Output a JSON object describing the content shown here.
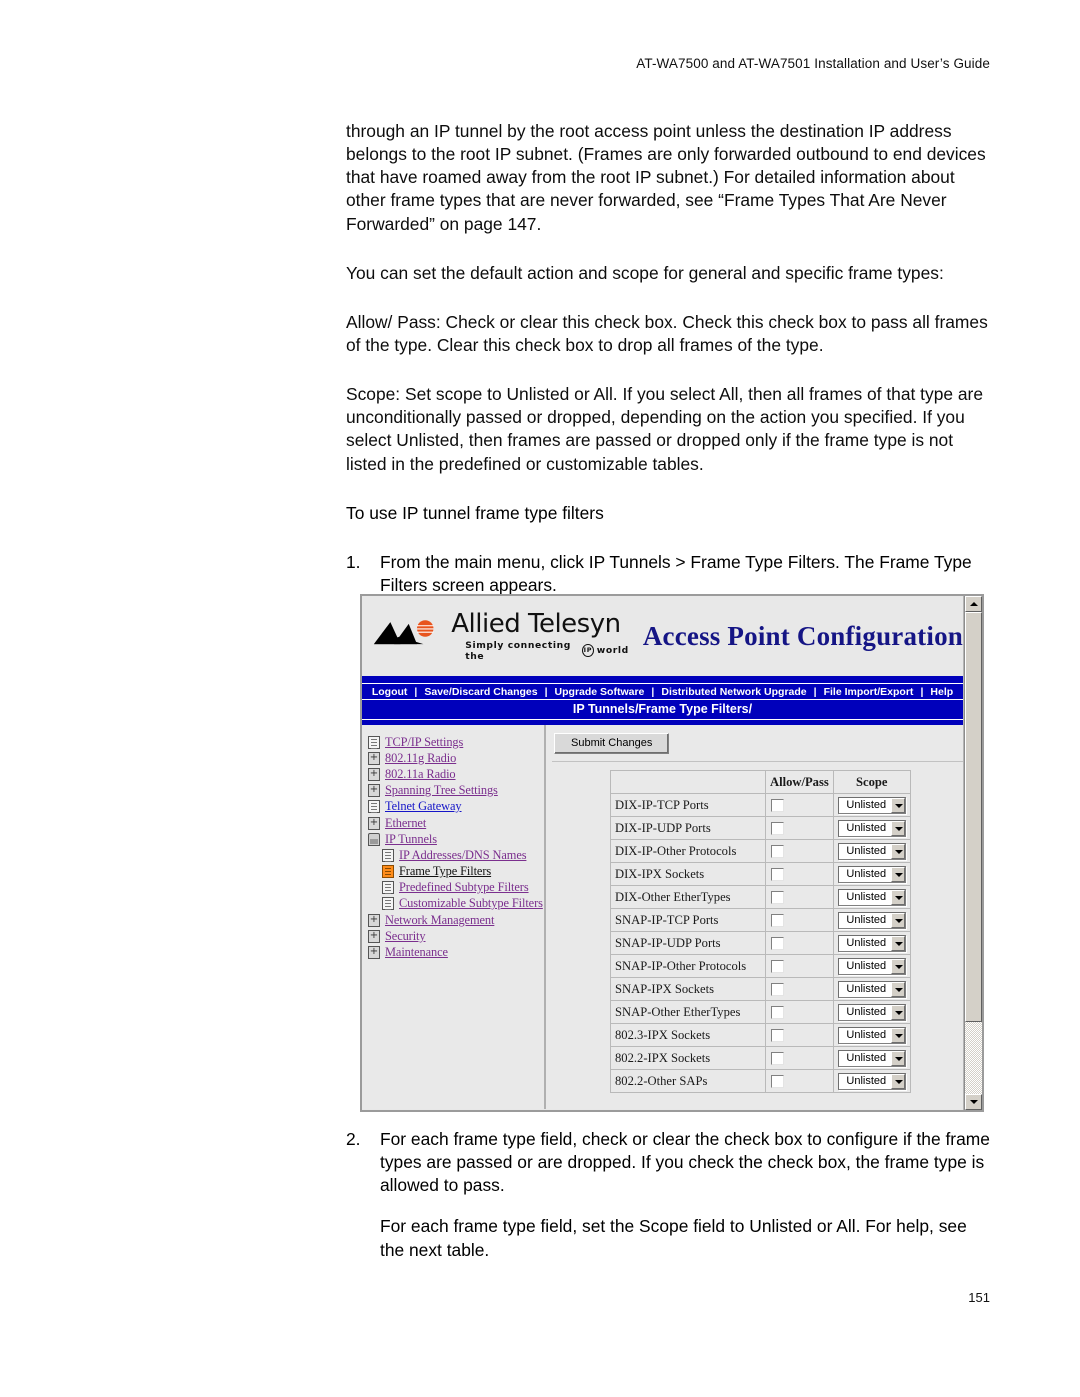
{
  "document": {
    "running_head": "AT-WA7500 and AT-WA7501 Installation and User’s Guide",
    "page_number": "151"
  },
  "body": {
    "paragraphs": [
      "through an IP tunnel by the root access point unless the destination IP address belongs to the root IP subnet. (Frames are only forwarded outbound to end devices that have roamed away from the root IP subnet.) For detailed information about other frame types that are never forwarded, see “Frame Types That Are Never Forwarded” on page 147.",
      "You can set the default action and scope for general and specific frame types:",
      "Allow/ Pass: Check or clear this check box. Check this check box to pass all frames of the type. Clear this check box to drop all frames of the type.",
      "Scope: Set scope to Unlisted or All. If you select All, then all frames of that type are unconditionally passed or dropped, depending on the action you specified. If you select Unlisted, then frames are passed or dropped only if the frame type is not listed in the predefined or customizable tables."
    ],
    "procedure_heading": "To use IP tunnel frame type filters",
    "step1_num": "1.",
    "step1_text": "From the main menu, click IP Tunnels > Frame Type Filters. The Frame Type Filters screen appears.",
    "step2_num": "2.",
    "step2_text": "For each frame type field, check or clear the check box to configure if the frame types are passed or are dropped. If you check the check box, the frame type is allowed to pass.",
    "step2_followup": "For each frame type field, set the Scope field to Unlisted or All. For help, see the next table."
  },
  "screenshot": {
    "brand": {
      "name": "Allied Telesyn",
      "tagline_before": "Simply  connecting  the",
      "tagline_ip": "IP",
      "tagline_after": "world"
    },
    "app_title": "Access Point Configuration",
    "menu_items": [
      "Logout",
      "Save/Discard Changes",
      "Upgrade Software",
      "Distributed Network Upgrade",
      "File Import/Export",
      "Help"
    ],
    "breadcrumb": "IP Tunnels/Frame Type Filters/",
    "submit_label": "Submit Changes",
    "nav_tree": [
      {
        "label": "TCP/IP Settings",
        "icon": "document-icon",
        "indent": 0,
        "state": "link"
      },
      {
        "label": "802.11g Radio",
        "icon": "folder-icon",
        "indent": 0,
        "state": "link"
      },
      {
        "label": "802.11a Radio",
        "icon": "folder-icon",
        "indent": 0,
        "state": "link"
      },
      {
        "label": "Spanning Tree Settings",
        "icon": "folder-icon",
        "indent": 0,
        "state": "link"
      },
      {
        "label": "Telnet Gateway",
        "icon": "document-icon",
        "indent": 0,
        "state": "unvisited"
      },
      {
        "label": "Ethernet",
        "icon": "folder-icon",
        "indent": 0,
        "state": "link"
      },
      {
        "label": "IP Tunnels",
        "icon": "folder-open-icon",
        "indent": 0,
        "state": "link"
      },
      {
        "label": "IP Addresses/DNS Names",
        "icon": "document-icon",
        "indent": 1,
        "state": "link"
      },
      {
        "label": "Frame Type Filters",
        "icon": "document-selected-icon",
        "indent": 1,
        "state": "current"
      },
      {
        "label": "Predefined Subtype Filters",
        "icon": "document-icon",
        "indent": 1,
        "state": "link"
      },
      {
        "label": "Customizable Subtype Filters",
        "icon": "document-icon",
        "indent": 1,
        "state": "link"
      },
      {
        "label": "Network Management",
        "icon": "folder-icon",
        "indent": 0,
        "state": "link"
      },
      {
        "label": "Security",
        "icon": "folder-icon",
        "indent": 0,
        "state": "link"
      },
      {
        "label": "Maintenance",
        "icon": "folder-icon",
        "indent": 0,
        "state": "link"
      }
    ],
    "table": {
      "headers": {
        "name": "",
        "allow_pass": "Allow/Pass",
        "scope": "Scope"
      },
      "scope_options": [
        "Unlisted",
        "All"
      ],
      "rows": [
        {
          "name": "DIX-IP-TCP Ports",
          "allow_pass": false,
          "scope": "Unlisted"
        },
        {
          "name": "DIX-IP-UDP Ports",
          "allow_pass": false,
          "scope": "Unlisted"
        },
        {
          "name": "DIX-IP-Other Protocols",
          "allow_pass": false,
          "scope": "Unlisted"
        },
        {
          "name": "DIX-IPX Sockets",
          "allow_pass": false,
          "scope": "Unlisted"
        },
        {
          "name": "DIX-Other EtherTypes",
          "allow_pass": false,
          "scope": "Unlisted"
        },
        {
          "name": "SNAP-IP-TCP Ports",
          "allow_pass": false,
          "scope": "Unlisted"
        },
        {
          "name": "SNAP-IP-UDP Ports",
          "allow_pass": false,
          "scope": "Unlisted"
        },
        {
          "name": "SNAP-IP-Other Protocols",
          "allow_pass": false,
          "scope": "Unlisted"
        },
        {
          "name": "SNAP-IPX Sockets",
          "allow_pass": false,
          "scope": "Unlisted"
        },
        {
          "name": "SNAP-Other EtherTypes",
          "allow_pass": false,
          "scope": "Unlisted"
        },
        {
          "name": "802.3-IPX Sockets",
          "allow_pass": false,
          "scope": "Unlisted"
        },
        {
          "name": "802.2-IPX Sockets",
          "allow_pass": false,
          "scope": "Unlisted"
        },
        {
          "name": "802.2-Other SAPs",
          "allow_pass": false,
          "scope": "Unlisted"
        }
      ]
    },
    "colors": {
      "menu_blue": "#0000bb",
      "title_navy": "#151585",
      "visited_link": "#7b2f8e",
      "unvisited_link": "#1515c8",
      "selected_icon": "#ff8c1a",
      "chrome_gray": "#e9e9e9"
    }
  }
}
